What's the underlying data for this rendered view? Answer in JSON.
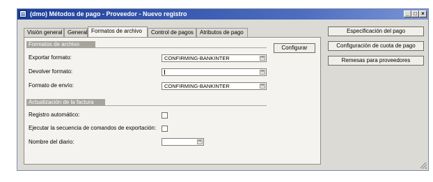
{
  "window": {
    "title": "(dmo) Métodos de pago - Proveedor - Nuevo registro",
    "controls": {
      "minimize": "_",
      "maximize": "□",
      "close": "×"
    }
  },
  "tabs": [
    {
      "label": "Visión general"
    },
    {
      "label": "General"
    },
    {
      "label": "Formatos de archivo",
      "active": true
    },
    {
      "label": "Control de pagos"
    },
    {
      "label": "Atributos de pago"
    }
  ],
  "file_formats": {
    "header": "Formatos de archivo",
    "export_label": "Exportar formato:",
    "export_value": "CONFIRMING-BANKINTER",
    "return_label": "Devolver formato:",
    "return_value": "",
    "send_label": "Formato de envío:",
    "send_value": "CONFIRMING-BANKINTER",
    "configure_button": "Configurar"
  },
  "invoice_update": {
    "header": "Actualización de la factura",
    "auto_register_label": "Registro automático:",
    "auto_register_checked": false,
    "run_sequence_label": "Ejecutar la secuencia de comandos de exportación:",
    "run_sequence_checked": false,
    "journal_name_label": "Nombre del diario:",
    "journal_name_value": ""
  },
  "side_buttons": {
    "payment_spec": "Especificación del pago",
    "fee_config": "Configuración de cuota de pago",
    "vendor_remittance": "Remesas para proveedores"
  },
  "icons": {
    "lookup": "lookup-arrow-icon"
  }
}
